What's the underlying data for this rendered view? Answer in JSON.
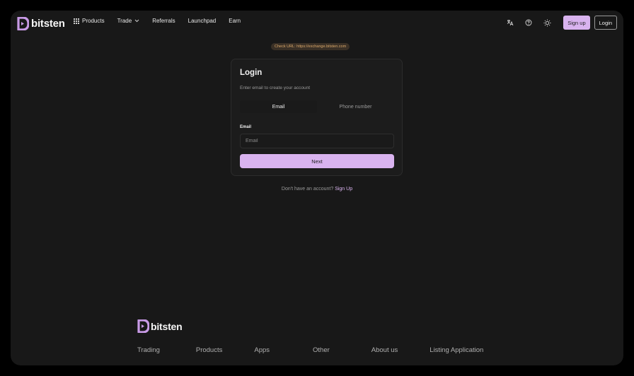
{
  "brand": {
    "name": "bitsten",
    "accent": "#d9b3ef",
    "logo_color": "#c89ae6"
  },
  "nav": {
    "items": [
      {
        "label": "Products",
        "icon": "grid-icon"
      },
      {
        "label": "Trade",
        "icon": "chevron-down-icon"
      },
      {
        "label": "Referrals"
      },
      {
        "label": "Launchpad"
      },
      {
        "label": "Earn"
      }
    ]
  },
  "header_right": {
    "icons": [
      "translate-icon",
      "help-icon",
      "theme-sun-icon"
    ],
    "signup_label": "Sign up",
    "login_label": "Login"
  },
  "url_notice": "Check URL: https://exchange.bitsten.com",
  "login": {
    "title": "Login",
    "subtitle": "Enter email to create your account",
    "tabs": [
      {
        "label": "Email",
        "active": true
      },
      {
        "label": "Phone number",
        "active": false
      }
    ],
    "email_label": "Email",
    "email_placeholder": "Email",
    "next_label": "Next"
  },
  "signup_prompt": {
    "text": "Don't have an account?",
    "link": "Sign Up"
  },
  "footer": {
    "links": [
      "Trading",
      "Products",
      "Apps",
      "Other",
      "About us",
      "Listing Application"
    ]
  }
}
